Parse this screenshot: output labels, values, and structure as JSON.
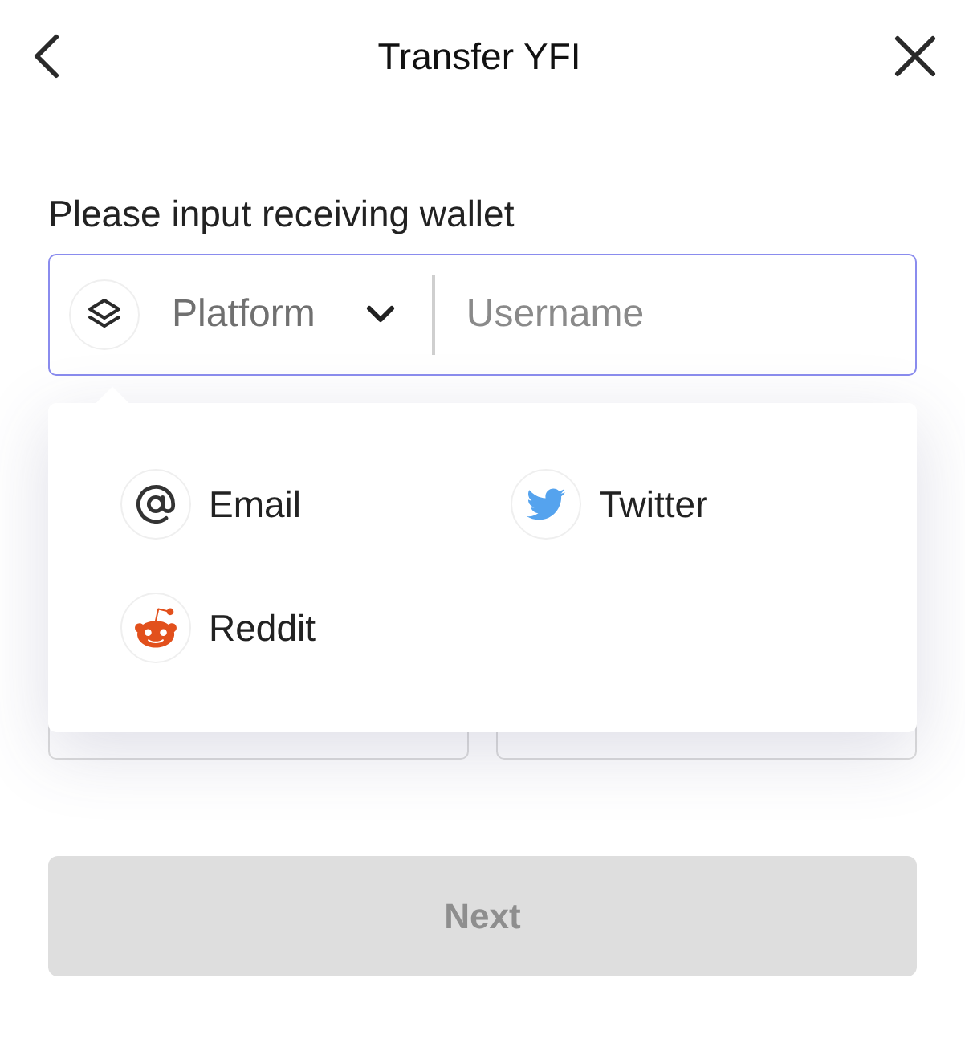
{
  "header": {
    "title": "Transfer YFI"
  },
  "wallet_input": {
    "label": "Please input receiving wallet",
    "platform": {
      "placeholder": "Platform",
      "expanded": true
    },
    "username": {
      "placeholder": "Username"
    }
  },
  "platform_menu": {
    "items": [
      {
        "kind": "email",
        "label": "Email"
      },
      {
        "kind": "twitter",
        "label": "Twitter"
      },
      {
        "kind": "reddit",
        "label": "Reddit"
      }
    ]
  },
  "next_button": {
    "label": "Next",
    "disabled": true
  }
}
